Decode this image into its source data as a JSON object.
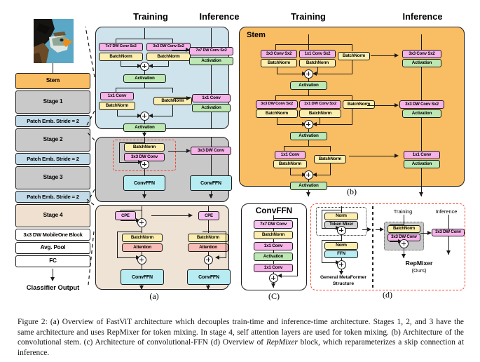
{
  "figure": {
    "caption_line1": "Figure 2: (a) Overview of FastViT architecture which decouples train-time and inference-time architecture. Stages 1, 2, and",
    "caption_line2": "3 have the same architecture and uses RepMixer for token mixing. In stage 4, self attention layers are used for token mixing.",
    "caption_line3": "(b) Architecture of the convolutional stem. (c) Architecture of convolutional-FFN (d) Overview of ",
    "caption_italic": "RepMixer",
    "caption_line3b": " block, which",
    "caption_line4": "reparameterizes a skip connection at inference."
  },
  "colors": {
    "conv": "#f5b3e8",
    "batchnorm": "#fbeeaf",
    "activation": "#bde8b4",
    "convffn": "#b6ecf2",
    "attention": "#f7bdb6",
    "stem": "#f9bd63",
    "stage": "#c9c9c9",
    "patch_embed": "#c3dbe8",
    "stage4": "#efe0d0",
    "panel_blue": "#cfe3ec",
    "panel_gray": "#c8c8c8",
    "panel_beige": "#efe3d6",
    "panel_orange": "#f9bd63",
    "highlight_red": "#f4432c"
  },
  "overview": {
    "blocks": [
      {
        "label": "Stem"
      },
      {
        "label": "Stage 1"
      },
      {
        "label": "Patch Emb. Stride = 2"
      },
      {
        "label": "Stage 2"
      },
      {
        "label": "Patch Emb. Stride = 2"
      },
      {
        "label": "Stage 3"
      },
      {
        "label": "Patch Emb. Stride = 2"
      },
      {
        "label": "Stage 4"
      },
      {
        "label": "3x3 DW MobileOne Block"
      },
      {
        "label": "Avg. Pool"
      },
      {
        "label": "FC"
      }
    ],
    "output_label": "Classifier Output",
    "input_image_alt": "bald-eagle-photo"
  },
  "panel_a": {
    "sublabel": "(a)",
    "col_training": "Training",
    "col_inference": "Inference",
    "stem_train": {
      "b1": "7x7 DW Conv Sx2",
      "b2": "BatchNorm",
      "b3": "3x3 DW Conv Sx2",
      "b4": "BatchNorm",
      "b5": "Activation",
      "b6": "1x1 Conv",
      "b7": "BatchNorm",
      "b8": "BatchNorm",
      "b9": "Activation"
    },
    "stem_infer": {
      "b1": "7x7 DW Conv Sx2",
      "b2": "Activation",
      "b3": "1x1 Conv",
      "b4": "Activation"
    },
    "mixer_train": {
      "b1": "BatchNorm",
      "b2": "3x3 DW Conv",
      "b3": "ConvFFN"
    },
    "mixer_infer": {
      "b1": "3x3 DW Conv",
      "b2": "ConvFFN"
    },
    "attn_train": {
      "b1": "CPE",
      "b2": "BatchNorm",
      "b3": "Attention",
      "b4": "ConvFFN"
    },
    "attn_infer": {
      "b1": "CPE",
      "b2": "BatchNorm",
      "b3": "Attention",
      "b4": "ConvFFN"
    }
  },
  "panel_b": {
    "sublabel": "(b)",
    "panel_title": "Stem",
    "col_training": "Training",
    "col_inference": "Inference",
    "training": {
      "r1c1": "3x3 Conv Sx2",
      "r1c2": "1x1 Conv Sx2",
      "r1c3": "BatchNorm",
      "r1c1b": "BatchNorm",
      "r1c2b": "BatchNorm",
      "act1": "Activation",
      "r2c1": "3x3 DW Conv Sx2",
      "r2c2": "1x1 DW Conv Sx2",
      "r2c3": "BatchNorm",
      "r2c1b": "BatchNorm",
      "r2c2b": "BatchNorm",
      "act2": "Activation",
      "r3c1": "1x1 Conv",
      "r3c1b": "BatchNorm",
      "r3c2": "BatchNorm",
      "act3": "Activation"
    },
    "inference": {
      "i1": "3x3 Conv Sx2",
      "i1a": "Activation",
      "i2": "3x3 DW Conv Sx2",
      "i2a": "Activation",
      "i3": "1x1 Conv",
      "i3a": "Activation"
    }
  },
  "panel_c": {
    "sublabel": "(C)",
    "title": "ConvFFN",
    "blocks": [
      {
        "label": "7x7 DW Conv"
      },
      {
        "label": "BatchNorm"
      },
      {
        "label": "1x1 Conv"
      },
      {
        "label": "Activation"
      },
      {
        "label": "1x1 Conv"
      }
    ]
  },
  "panel_d": {
    "sublabel": "(d)",
    "metaformer": {
      "b1": "Norm",
      "b2": "Token Mixer",
      "b3": "Norm",
      "b4": "FFN",
      "caption_l1": "General MetaFormer",
      "caption_l2": "Structure"
    },
    "repmixer": {
      "col_training": "Training",
      "col_inference": "Inference",
      "b1": "BatchNorm",
      "b2": "3x3 DW Conv",
      "b3": "3x3 DW Conv",
      "name": "RepMixer",
      "ours": "(Ours)"
    }
  }
}
